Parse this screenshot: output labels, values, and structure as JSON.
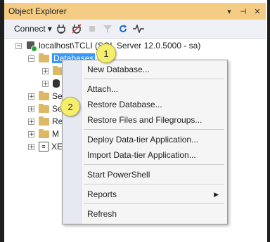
{
  "panel": {
    "title": "Object Explorer",
    "controls": [
      "▾",
      "⊣",
      "✕"
    ]
  },
  "toolbar": {
    "connect_label": "Connect",
    "connect_arrow": "▾"
  },
  "tree": {
    "server": "localhost\\TCLI (SQL Server 12.0.5000 - sa)",
    "databases": "Databases",
    "truncated": {
      "item1": "Se",
      "item2": "Se",
      "item3": "Re",
      "item4": "M",
      "item5": "XE"
    }
  },
  "context_menu": {
    "new_database": "New Database...",
    "attach": "Attach...",
    "restore_database": "Restore Database...",
    "restore_files": "Restore Files and Filegroups...",
    "deploy_datatier": "Deploy Data-tier Application...",
    "import_datatier": "Import Data-tier Application...",
    "start_powershell": "Start PowerShell",
    "reports": "Reports",
    "reports_arrow": "▶",
    "refresh": "Refresh"
  },
  "callouts": {
    "one": "1",
    "two": "2"
  },
  "colors": {
    "title_bar": "#f5cc84",
    "selection": "#3399ff",
    "callout": "#f4ee6b"
  }
}
